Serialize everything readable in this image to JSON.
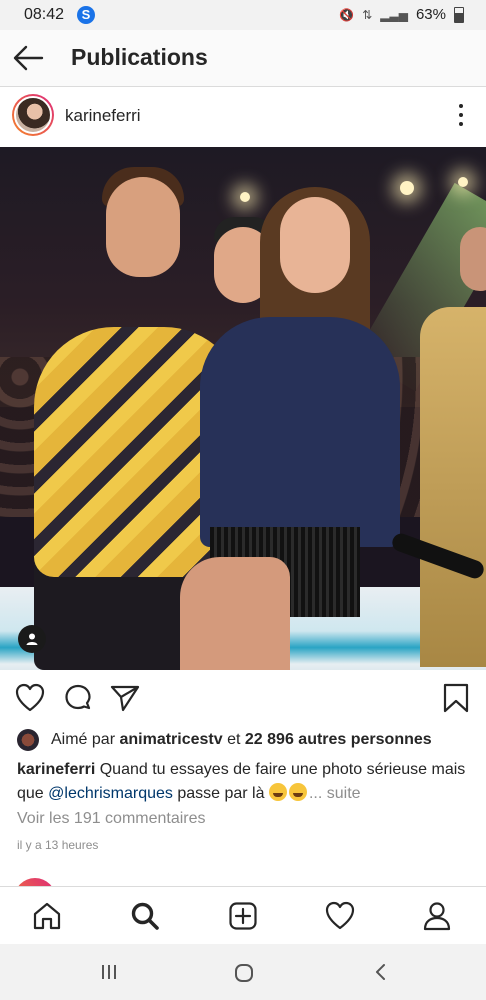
{
  "status_bar": {
    "time": "08:42",
    "app_icon": "S",
    "battery": "63%",
    "battery_level": 0.63
  },
  "header": {
    "title": "Publications"
  },
  "post": {
    "username": "karineferri",
    "actions": {
      "like_icon": "heart-icon",
      "comment_icon": "comment-icon",
      "share_icon": "send-icon",
      "save_icon": "bookmark-icon"
    },
    "likes": {
      "prefix": "Aimé par",
      "user": "animatricestv",
      "middle": "et",
      "others": "22 896 autres personnes"
    },
    "caption": {
      "username": "karineferri",
      "text1": "Quand tu essayes de faire une photo sérieuse mais que",
      "mention": "@lechrismarques",
      "text2": "passe par là",
      "more": "... suite"
    },
    "view_comments": "Voir les 191 commentaires",
    "time_ago": "il y a 13 heures"
  },
  "tabs": [
    "home",
    "search",
    "add",
    "activity",
    "profile"
  ],
  "colors": {
    "text": "#262626",
    "secondary": "#8e8e8e",
    "mention": "#00376b",
    "border": "#dbdbdb"
  }
}
